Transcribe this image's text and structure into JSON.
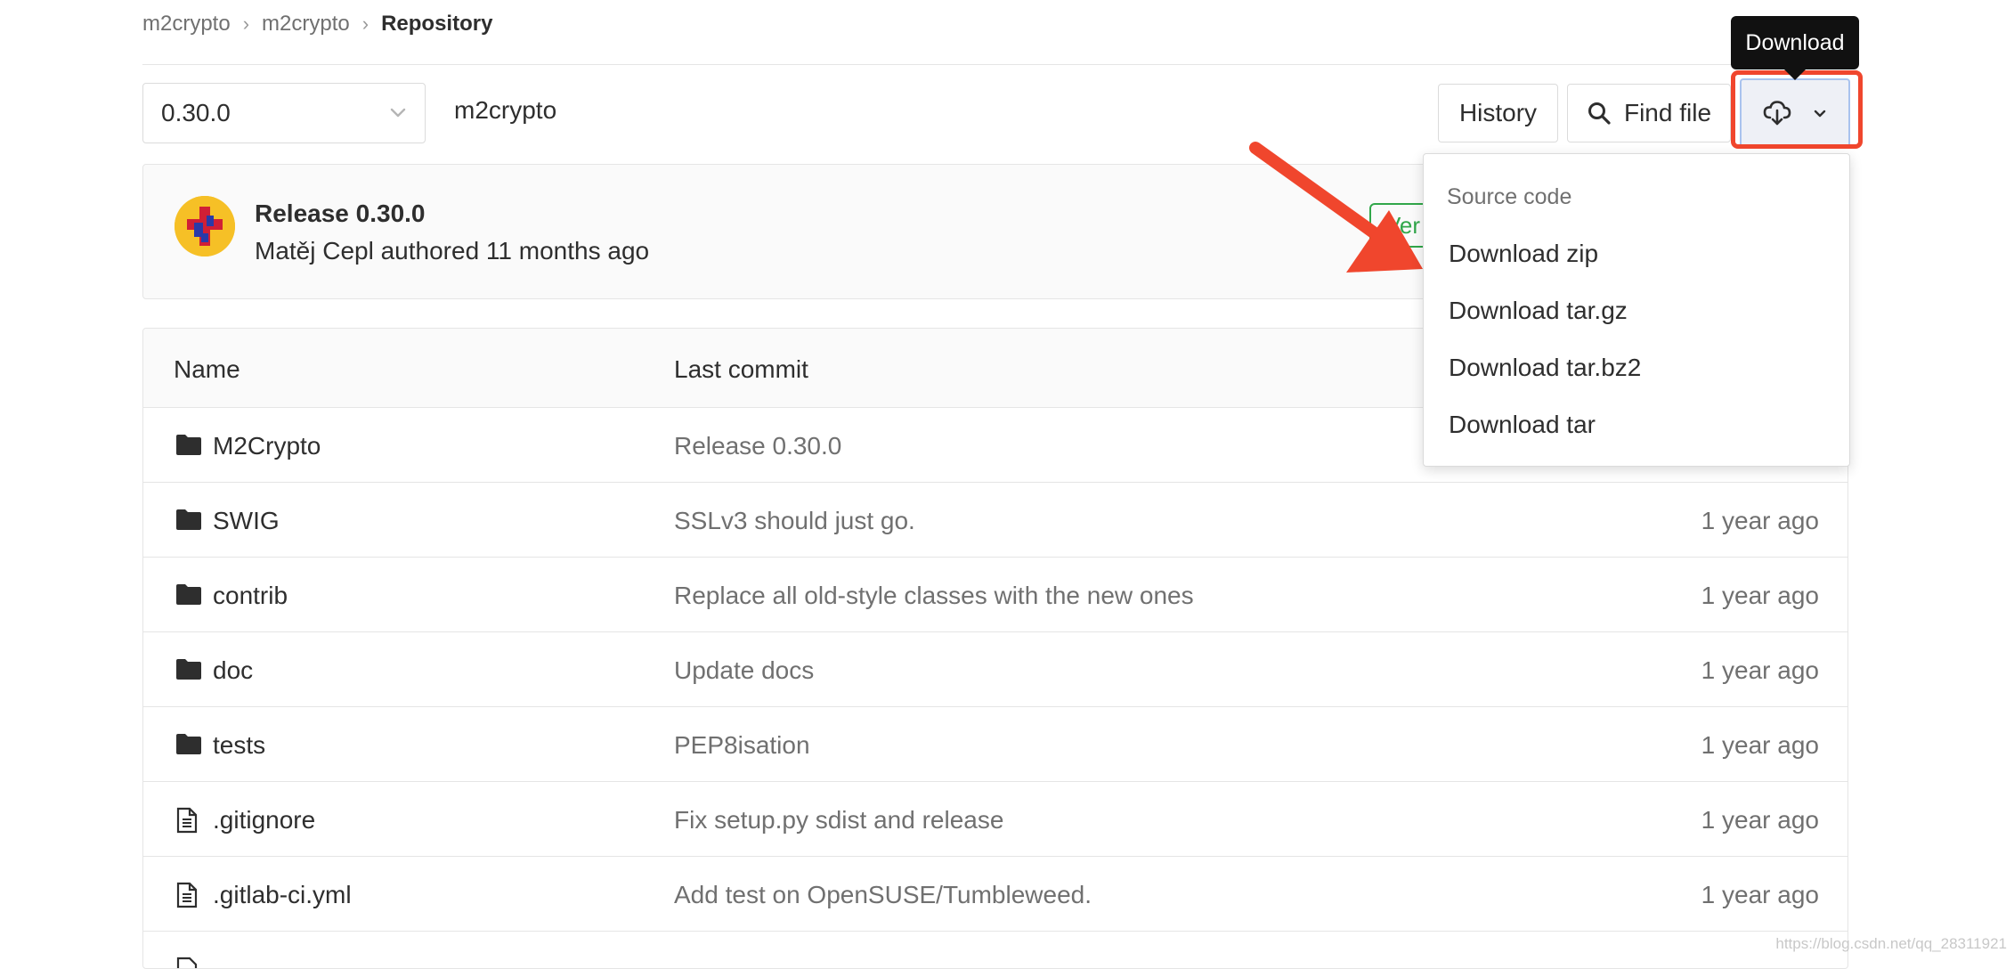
{
  "breadcrumb": {
    "items": [
      "m2crypto",
      "m2crypto"
    ],
    "current": "Repository"
  },
  "branch_select": {
    "value": "0.30.0"
  },
  "repo_path": "m2crypto",
  "toolbar": {
    "history_label": "History",
    "find_file_label": "Find file",
    "download_tooltip": "Download"
  },
  "commit": {
    "title": "Release 0.30.0",
    "meta": "Matěj Cepl authored 11 months ago",
    "badge_partial": "Ver"
  },
  "table": {
    "columns": [
      "Name",
      "Last commit"
    ],
    "rows": [
      {
        "name": "M2Crypto",
        "commit": "Release 0.30.0",
        "date": "",
        "icon": "folder-icon"
      },
      {
        "name": "SWIG",
        "commit": "SSLv3 should just go.",
        "date": "1 year ago",
        "icon": "folder-icon"
      },
      {
        "name": "contrib",
        "commit": "Replace all old-style classes with the new ones",
        "date": "1 year ago",
        "icon": "folder-icon"
      },
      {
        "name": "doc",
        "commit": "Update docs",
        "date": "1 year ago",
        "icon": "folder-icon"
      },
      {
        "name": "tests",
        "commit": "PEP8isation",
        "date": "1 year ago",
        "icon": "folder-icon"
      },
      {
        "name": ".gitignore",
        "commit": "Fix setup.py sdist and release",
        "date": "1 year ago",
        "icon": "file-icon"
      },
      {
        "name": ".gitlab-ci.yml",
        "commit": "Add test on OpenSUSE/Tumbleweed.",
        "date": "1 year ago",
        "icon": "file-icon"
      }
    ]
  },
  "dropdown": {
    "header": "Source code",
    "items": [
      "Download zip",
      "Download tar.gz",
      "Download tar.bz2",
      "Download tar"
    ]
  },
  "watermark": "https://blog.csdn.net/qq_28311921",
  "colors": {
    "annotation_red": "#f0462d",
    "verified_green": "#31a74a",
    "tooltip_bg": "#111111"
  }
}
